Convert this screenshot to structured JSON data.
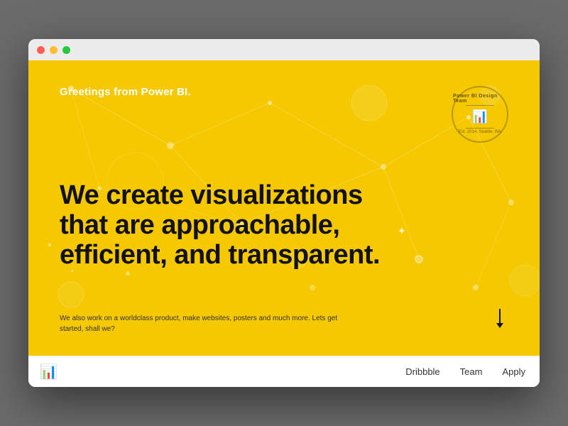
{
  "window": {
    "title": "Power BI Design Team"
  },
  "titlebar": {
    "dots": [
      "red",
      "yellow",
      "green"
    ]
  },
  "hero": {
    "greeting": "Greetings from Power BI.",
    "headline": "We create visualizations\nthat are approachable,\nefficient, and transparent.",
    "subtext": "We also work on a worldclass product, make websites, posters and much more. Lets get started, shall we?",
    "badge": {
      "top": "Power BI Design Team",
      "middle": "—  ■  —",
      "bottom": "Est. 2014, Seattle, WA"
    },
    "colors": {
      "background": "#f5c800",
      "headline": "#111111",
      "subtext": "#333333"
    }
  },
  "navbar": {
    "logo_label": "power-bi-logo",
    "links": [
      {
        "label": "Dribbble",
        "href": "#"
      },
      {
        "label": "Team",
        "href": "#"
      },
      {
        "label": "Apply",
        "href": "#"
      }
    ]
  }
}
